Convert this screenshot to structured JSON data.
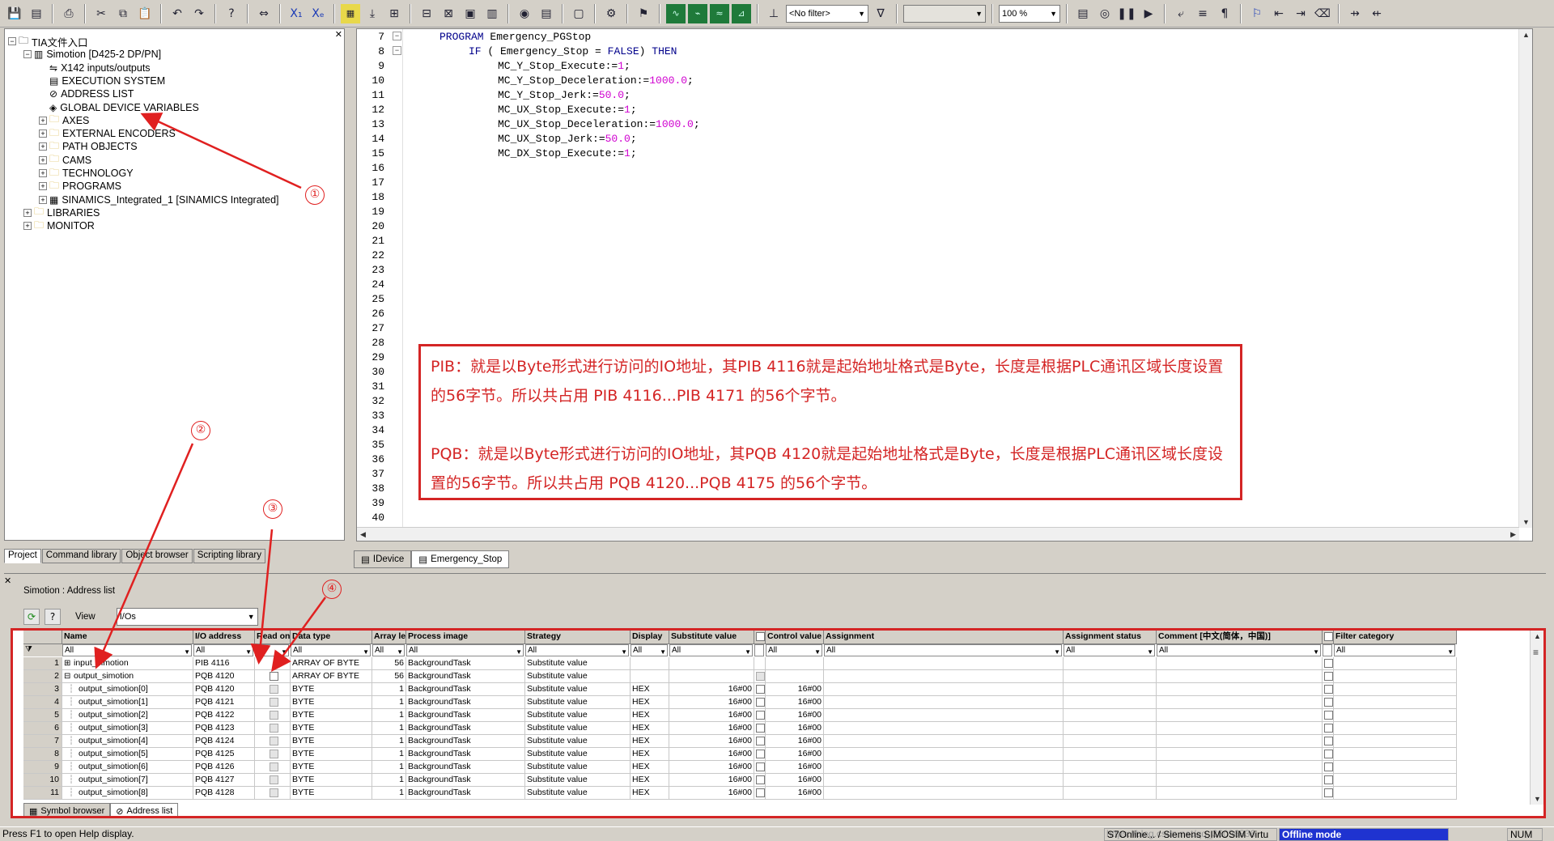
{
  "toolbar": {
    "filter_value": "<No filter>",
    "zoom_value": "100 %",
    "empty_combo_value": ""
  },
  "tree": {
    "items": [
      {
        "label": "TIA文件入口",
        "level": 0,
        "expander": "−",
        "icon": "project-icon"
      },
      {
        "label": "Simotion [D425-2 DP/PN]",
        "level": 1,
        "expander": "−",
        "icon": "device-icon"
      },
      {
        "label": "X142 inputs/outputs",
        "level": 2,
        "expander": "",
        "icon": "io-icon"
      },
      {
        "label": "EXECUTION SYSTEM",
        "level": 2,
        "expander": "",
        "icon": "execution-icon"
      },
      {
        "label": "ADDRESS LIST",
        "level": 2,
        "expander": "",
        "icon": "address-list-icon"
      },
      {
        "label": "GLOBAL DEVICE VARIABLES",
        "level": 2,
        "expander": "",
        "icon": "variables-icon"
      },
      {
        "label": "AXES",
        "level": 2,
        "expander": "+",
        "icon": "folder-icon"
      },
      {
        "label": "EXTERNAL ENCODERS",
        "level": 2,
        "expander": "+",
        "icon": "folder-icon"
      },
      {
        "label": "PATH OBJECTS",
        "level": 2,
        "expander": "+",
        "icon": "folder-icon"
      },
      {
        "label": "CAMS",
        "level": 2,
        "expander": "+",
        "icon": "folder-icon"
      },
      {
        "label": "TECHNOLOGY",
        "level": 2,
        "expander": "+",
        "icon": "folder-icon"
      },
      {
        "label": "PROGRAMS",
        "level": 2,
        "expander": "+",
        "icon": "folder-icon"
      },
      {
        "label": "SINAMICS_Integrated_1 [SINAMICS Integrated]",
        "level": 2,
        "expander": "+",
        "icon": "drive-icon"
      },
      {
        "label": "LIBRARIES",
        "level": 1,
        "expander": "+",
        "icon": "folder-icon"
      },
      {
        "label": "MONITOR",
        "level": 1,
        "expander": "+",
        "icon": "folder-icon"
      }
    ],
    "tabs": [
      "Project",
      "Command library",
      "Object browser",
      "Scripting library"
    ]
  },
  "editor": {
    "line_numbers": [
      "7",
      "8",
      "9",
      "10",
      "11",
      "12",
      "13",
      "14",
      "15",
      "16",
      "17",
      "18",
      "19",
      "20",
      "21",
      "22",
      "23",
      "24",
      "25",
      "26",
      "27",
      "28",
      "29",
      "30",
      "31",
      "32",
      "33",
      "34",
      "35",
      "36",
      "37",
      "38",
      "39",
      "40"
    ],
    "code_lines": [
      {
        "indent": 0,
        "parts": [
          {
            "t": "PROGRAM",
            "k": "kw"
          },
          {
            "t": " Emergency_PGStop",
            "k": ""
          }
        ]
      },
      {
        "indent": 1,
        "parts": [
          {
            "t": "IF",
            "k": "kw"
          },
          {
            "t": " ( Emergency_Stop = ",
            "k": ""
          },
          {
            "t": "FALSE",
            "k": "kw"
          },
          {
            "t": ") ",
            "k": ""
          },
          {
            "t": "THEN",
            "k": "kw"
          }
        ]
      },
      {
        "indent": 2,
        "parts": [
          {
            "t": "MC_Y_Stop_Execute:=",
            "k": ""
          },
          {
            "t": "1",
            "k": "num"
          },
          {
            "t": ";",
            "k": ""
          }
        ]
      },
      {
        "indent": 2,
        "parts": [
          {
            "t": "MC_Y_Stop_Deceleration:=",
            "k": ""
          },
          {
            "t": "1000.0",
            "k": "num"
          },
          {
            "t": ";",
            "k": ""
          }
        ]
      },
      {
        "indent": 2,
        "parts": [
          {
            "t": "MC_Y_Stop_Jerk:=",
            "k": ""
          },
          {
            "t": "50.0",
            "k": "num"
          },
          {
            "t": ";",
            "k": ""
          }
        ]
      },
      {
        "indent": 2,
        "parts": [
          {
            "t": "MC_UX_Stop_Execute:=",
            "k": ""
          },
          {
            "t": "1",
            "k": "num"
          },
          {
            "t": ";",
            "k": ""
          }
        ]
      },
      {
        "indent": 2,
        "parts": [
          {
            "t": "MC_UX_Stop_Deceleration:=",
            "k": ""
          },
          {
            "t": "1000.0",
            "k": "num"
          },
          {
            "t": ";",
            "k": ""
          }
        ]
      },
      {
        "indent": 2,
        "parts": [
          {
            "t": "MC_UX_Stop_Jerk:=",
            "k": ""
          },
          {
            "t": "50.0",
            "k": "num"
          },
          {
            "t": ";",
            "k": ""
          }
        ]
      },
      {
        "indent": 2,
        "parts": [
          {
            "t": "MC_DX_Stop_Execute:=",
            "k": ""
          },
          {
            "t": "1",
            "k": "num"
          },
          {
            "t": ";",
            "k": ""
          }
        ]
      }
    ],
    "note_paragraphs": [
      "PIB：就是以Byte形式进行访问的IO地址，其PIB 4116就是起始地址格式是Byte，长度是根据PLC通讯区域长度设置的56字节。所以共占用  PIB 4116...PIB 4171  的56个字节。",
      "PQB：就是以Byte形式进行访问的IO地址，其PQB 4120就是起始地址格式是Byte，长度是根据PLC通讯区域长度设置的56字节。所以共占用  PQB 4120...PQB 4175  的56个字节。"
    ],
    "tabs": [
      "IDevice",
      "Emergency_Stop"
    ]
  },
  "address_list": {
    "title": "Simotion : Address list",
    "view_label": "View",
    "view_value": "I/Os",
    "columns": [
      "Name",
      "I/O address",
      "Read only",
      "Data type",
      "Array length",
      "Process image",
      "Strategy",
      "Display",
      "Substitute value",
      "",
      "Control value",
      "Assignment",
      "Assignment status",
      "Comment [中文(简体，中国)]",
      "",
      "Filter category"
    ],
    "filters": [
      "All",
      "All",
      "All",
      "All",
      "All",
      "All",
      "All",
      "All",
      "All",
      "All",
      "All",
      "All",
      "All",
      "All",
      "All",
      "All"
    ],
    "rows": [
      {
        "n": "1",
        "exp": "+",
        "name": "input_simotion",
        "addr": "PIB 4116",
        "ro": "",
        "type": "ARRAY OF BYTE",
        "len": "56",
        "pi": "BackgroundTask",
        "strat": "Substitute value",
        "disp": "",
        "sub": "",
        "cb1": "",
        "ctrl": "",
        "cb2": "box"
      },
      {
        "n": "2",
        "exp": "−",
        "name": "output_simotion",
        "addr": "PQB 4120",
        "ro": "box",
        "type": "ARRAY OF BYTE",
        "len": "56",
        "pi": "BackgroundTask",
        "strat": "Substitute value",
        "disp": "",
        "sub": "",
        "cb1": "grey",
        "ctrl": "",
        "cb2": "box"
      },
      {
        "n": "3",
        "exp": "",
        "name": "output_simotion[0]",
        "addr": "PQB 4120",
        "ro": "grey",
        "type": "BYTE",
        "len": "1",
        "pi": "BackgroundTask",
        "strat": "Substitute value",
        "disp": "HEX",
        "sub": "16#00",
        "cb1": "box",
        "ctrl": "16#00",
        "cb2": "box"
      },
      {
        "n": "4",
        "exp": "",
        "name": "output_simotion[1]",
        "addr": "PQB 4121",
        "ro": "grey",
        "type": "BYTE",
        "len": "1",
        "pi": "BackgroundTask",
        "strat": "Substitute value",
        "disp": "HEX",
        "sub": "16#00",
        "cb1": "box",
        "ctrl": "16#00",
        "cb2": "box"
      },
      {
        "n": "5",
        "exp": "",
        "name": "output_simotion[2]",
        "addr": "PQB 4122",
        "ro": "grey",
        "type": "BYTE",
        "len": "1",
        "pi": "BackgroundTask",
        "strat": "Substitute value",
        "disp": "HEX",
        "sub": "16#00",
        "cb1": "box",
        "ctrl": "16#00",
        "cb2": "box"
      },
      {
        "n": "6",
        "exp": "",
        "name": "output_simotion[3]",
        "addr": "PQB 4123",
        "ro": "grey",
        "type": "BYTE",
        "len": "1",
        "pi": "BackgroundTask",
        "strat": "Substitute value",
        "disp": "HEX",
        "sub": "16#00",
        "cb1": "box",
        "ctrl": "16#00",
        "cb2": "box"
      },
      {
        "n": "7",
        "exp": "",
        "name": "output_simotion[4]",
        "addr": "PQB 4124",
        "ro": "grey",
        "type": "BYTE",
        "len": "1",
        "pi": "BackgroundTask",
        "strat": "Substitute value",
        "disp": "HEX",
        "sub": "16#00",
        "cb1": "box",
        "ctrl": "16#00",
        "cb2": "box"
      },
      {
        "n": "8",
        "exp": "",
        "name": "output_simotion[5]",
        "addr": "PQB 4125",
        "ro": "grey",
        "type": "BYTE",
        "len": "1",
        "pi": "BackgroundTask",
        "strat": "Substitute value",
        "disp": "HEX",
        "sub": "16#00",
        "cb1": "box",
        "ctrl": "16#00",
        "cb2": "box"
      },
      {
        "n": "9",
        "exp": "",
        "name": "output_simotion[6]",
        "addr": "PQB 4126",
        "ro": "grey",
        "type": "BYTE",
        "len": "1",
        "pi": "BackgroundTask",
        "strat": "Substitute value",
        "disp": "HEX",
        "sub": "16#00",
        "cb1": "box",
        "ctrl": "16#00",
        "cb2": "box"
      },
      {
        "n": "10",
        "exp": "",
        "name": "output_simotion[7]",
        "addr": "PQB 4127",
        "ro": "grey",
        "type": "BYTE",
        "len": "1",
        "pi": "BackgroundTask",
        "strat": "Substitute value",
        "disp": "HEX",
        "sub": "16#00",
        "cb1": "box",
        "ctrl": "16#00",
        "cb2": "box"
      },
      {
        "n": "11",
        "exp": "",
        "name": "output_simotion[8]",
        "addr": "PQB 4128",
        "ro": "grey",
        "type": "BYTE",
        "len": "1",
        "pi": "BackgroundTask",
        "strat": "Substitute value",
        "disp": "HEX",
        "sub": "16#00",
        "cb1": "box",
        "ctrl": "16#00",
        "cb2": "box"
      }
    ],
    "tabs": [
      "Symbol browser",
      "Address list"
    ]
  },
  "annotations": [
    "①",
    "②",
    "③",
    "④"
  ],
  "annotation_color": "#e02020",
  "status": {
    "help": "Press F1 to open Help display.",
    "connection": "S7Online... / Siemens SIMOSIM Virtu",
    "mode": "Offline mode",
    "watermark": "https://blog.csdn.net/qq_36096836",
    "num": "NUM"
  }
}
